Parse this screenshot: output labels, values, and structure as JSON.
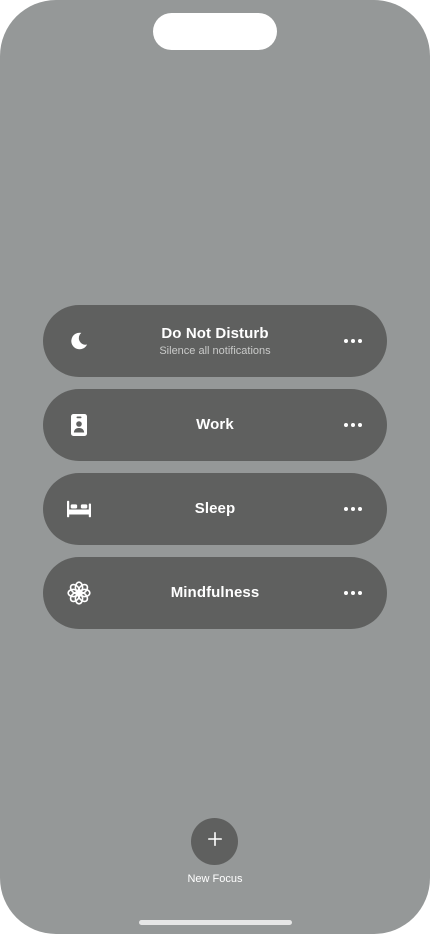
{
  "focus_modes": [
    {
      "title": "Do Not Disturb",
      "subtitle": "Silence all notifications",
      "icon": "moon-icon"
    },
    {
      "title": "Work",
      "subtitle": "",
      "icon": "id-badge-icon"
    },
    {
      "title": "Sleep",
      "subtitle": "",
      "icon": "bed-icon"
    },
    {
      "title": "Mindfulness",
      "subtitle": "",
      "icon": "flower-icon"
    }
  ],
  "new_focus": {
    "label": "New Focus",
    "icon": "plus-icon"
  },
  "colors": {
    "background": "#959898",
    "pill": "#5f605f",
    "text": "#ffffff"
  }
}
